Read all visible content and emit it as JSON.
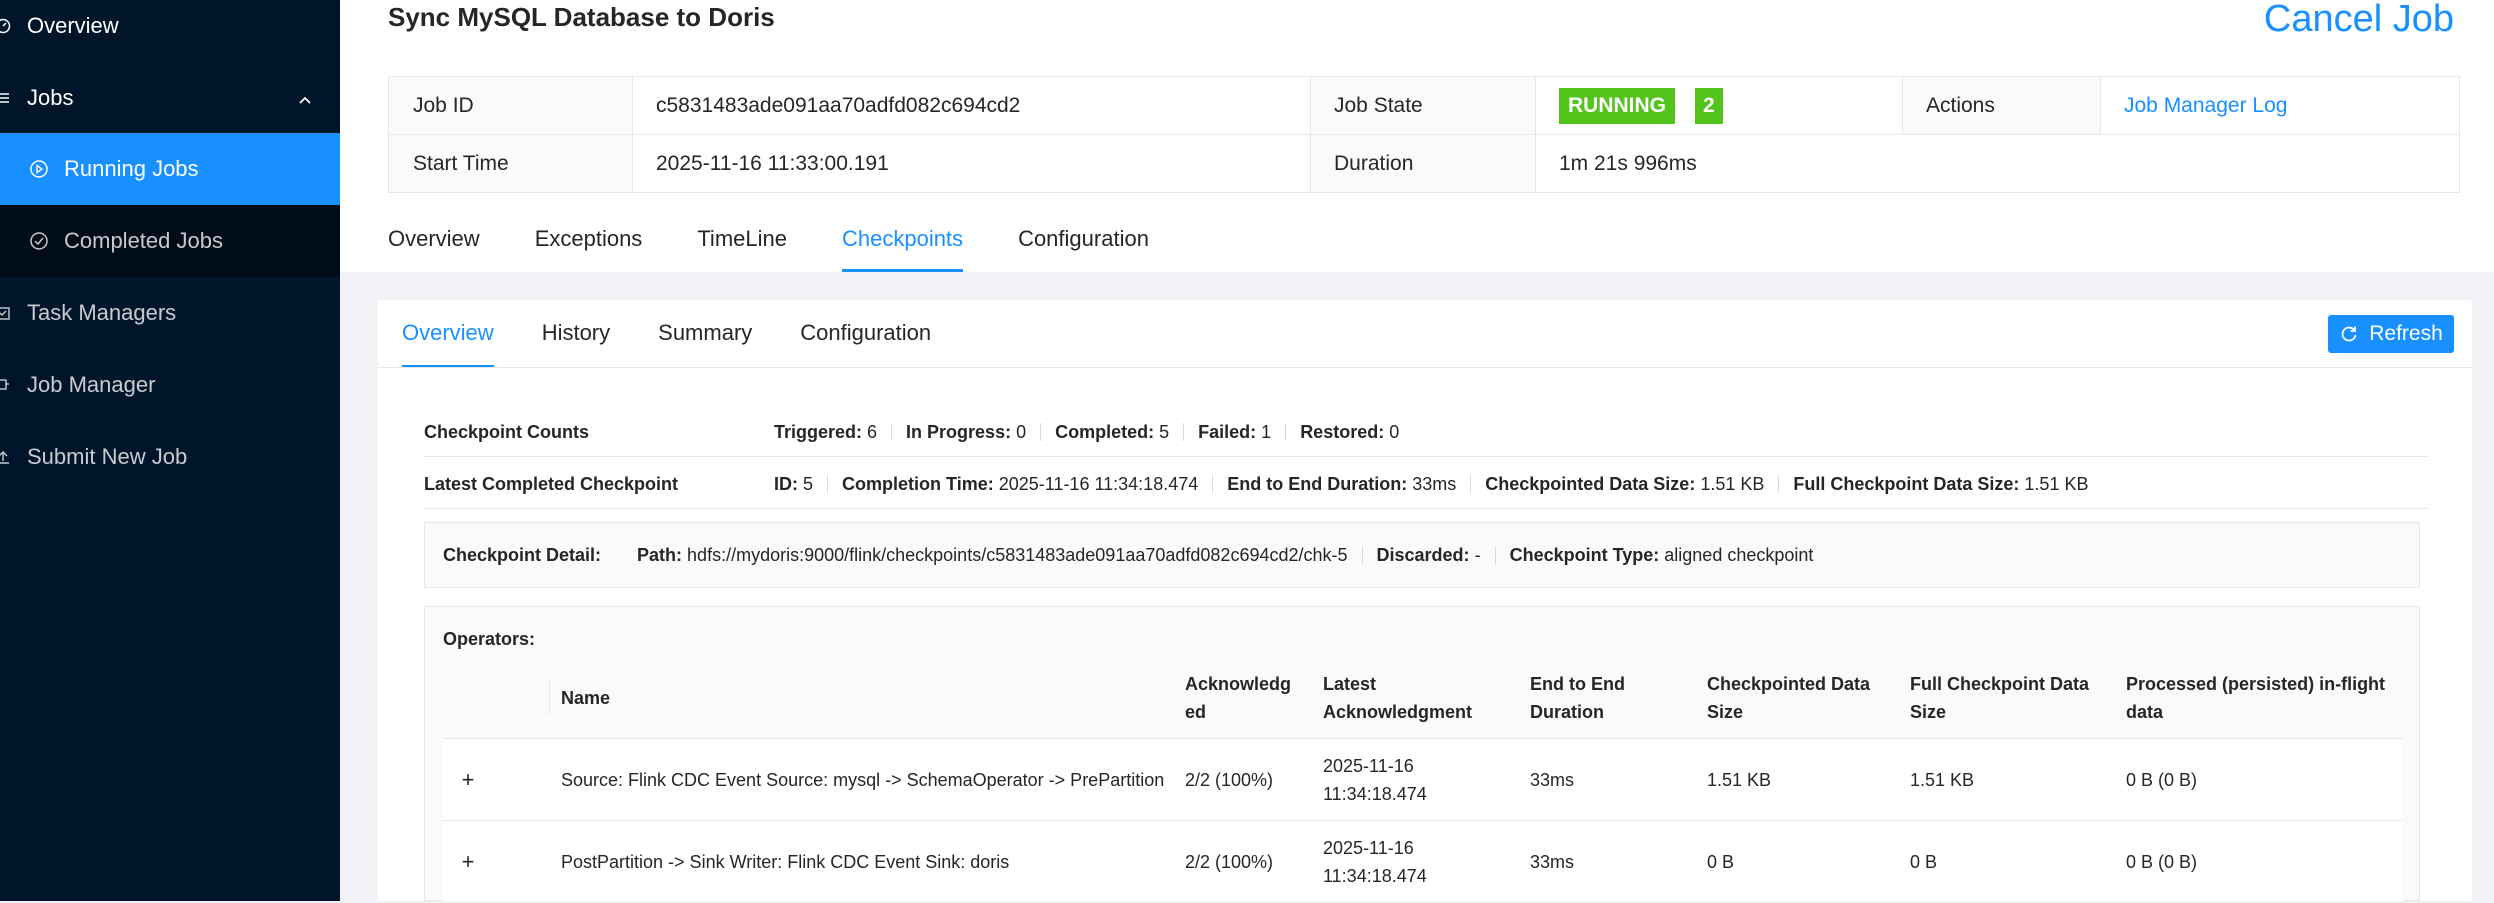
{
  "sidebar": {
    "items": [
      {
        "label": "Overview",
        "icon": "dashboard-icon"
      },
      {
        "label": "Jobs",
        "icon": "menu-icon"
      },
      {
        "label": "Running Jobs",
        "icon": "play-circle-icon"
      },
      {
        "label": "Completed Jobs",
        "icon": "check-circle-icon"
      },
      {
        "label": "Task Managers",
        "icon": "schedule-icon"
      },
      {
        "label": "Job Manager",
        "icon": "build-icon"
      },
      {
        "label": "Submit New Job",
        "icon": "upload-icon"
      }
    ]
  },
  "job": {
    "title": "Sync MySQL Database to Doris",
    "cancel_label": "Cancel Job",
    "id_label": "Job ID",
    "id": "c5831483ade091aa70adfd082c694cd2",
    "state_label": "Job State",
    "state": "RUNNING",
    "state_count": "2",
    "actions_label": "Actions",
    "actions_link": "Job Manager Log",
    "start_label": "Start Time",
    "start": "2025-11-16 11:33:00.191",
    "duration_label": "Duration",
    "duration": "1m 21s 996ms"
  },
  "tabs": [
    "Overview",
    "Exceptions",
    "TimeLine",
    "Checkpoints",
    "Configuration"
  ],
  "subtabs": [
    "Overview",
    "History",
    "Summary",
    "Configuration"
  ],
  "refresh_label": "Refresh",
  "counts": {
    "label": "Checkpoint Counts",
    "triggered_k": "Triggered:",
    "triggered_v": "6",
    "inprogress_k": "In Progress:",
    "inprogress_v": "0",
    "completed_k": "Completed:",
    "completed_v": "5",
    "failed_k": "Failed:",
    "failed_v": "1",
    "restored_k": "Restored:",
    "restored_v": "0"
  },
  "latest": {
    "label": "Latest Completed Checkpoint",
    "id_k": "ID:",
    "id_v": "5",
    "time_k": "Completion Time:",
    "time_v": "2025-11-16 11:34:18.474",
    "e2e_k": "End to End Duration:",
    "e2e_v": "33ms",
    "size_k": "Checkpointed Data Size:",
    "size_v": "1.51 KB",
    "full_k": "Full Checkpoint Data Size:",
    "full_v": "1.51 KB"
  },
  "detail": {
    "label": "Checkpoint Detail:",
    "path_k": "Path:",
    "path_v": "hdfs://mydoris:9000/flink/checkpoints/c5831483ade091aa70adfd082c694cd2/chk-5",
    "discarded_k": "Discarded:",
    "discarded_v": "-",
    "type_k": "Checkpoint Type:",
    "type_v": "aligned checkpoint"
  },
  "operators": {
    "label": "Operators:",
    "headers": {
      "name": "Name",
      "ack": "Acknowledg ed",
      "latest": "Latest Acknowledgment",
      "e2e": "End to End Duration",
      "size": "Checkpointed Data Size",
      "full": "Full Checkpoint Data Size",
      "processed": "Processed (persisted) in-flight data"
    },
    "rows": [
      {
        "name": "Source: Flink CDC Event Source: mysql -> SchemaOperator -> PrePartition",
        "ack": "2/2 (100%)",
        "latest": "2025-11-16 11:34:18.474",
        "e2e": "33ms",
        "size": "1.51 KB",
        "full": "1.51 KB",
        "processed": "0 B (0 B)"
      },
      {
        "name": "PostPartition -> Sink Writer: Flink CDC Event Sink: doris",
        "ack": "2/2 (100%)",
        "latest": "2025-11-16 11:34:18.474",
        "e2e": "33ms",
        "size": "0 B",
        "full": "0 B",
        "processed": "0 B (0 B)"
      }
    ]
  }
}
